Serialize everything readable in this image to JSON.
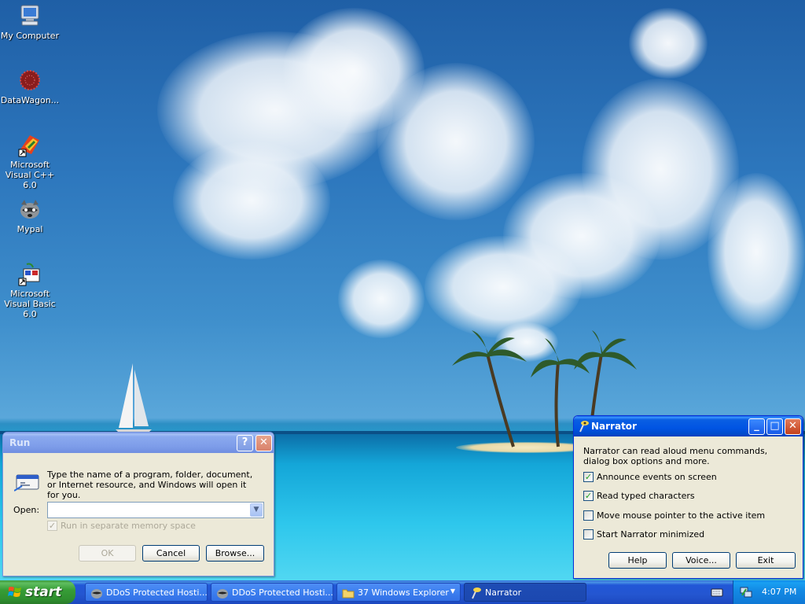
{
  "desktop": {
    "icons": [
      {
        "label": "My Computer",
        "icon": "computer-icon"
      },
      {
        "label": "DataWagon...",
        "icon": "network-globe-icon"
      },
      {
        "label": "Microsoft Visual C++ 6.0",
        "icon": "visual-cpp-icon"
      },
      {
        "label": "Mypal",
        "icon": "raccoon-browser-icon"
      },
      {
        "label": "Microsoft Visual Basic 6.0",
        "icon": "visual-basic-icon"
      }
    ]
  },
  "run_dialog": {
    "title": "Run",
    "help_button": "?",
    "close_button": "✕",
    "description": "Type the name of a program, folder, document, or Internet resource, and Windows will open it for you.",
    "open_label": "Open:",
    "open_value": "",
    "separate_memory_label": "Run in separate memory space",
    "separate_memory_checked": true,
    "ok_label": "OK",
    "cancel_label": "Cancel",
    "browse_label": "Browse..."
  },
  "narrator": {
    "title": "Narrator",
    "minimize": "_",
    "maximize": "□",
    "close": "✕",
    "description": "Narrator can read aloud menu commands, dialog box options and more.",
    "options": [
      {
        "label": "Announce events on screen",
        "checked": true
      },
      {
        "label": "Read typed characters",
        "checked": true
      },
      {
        "label": "Move mouse pointer to the active item",
        "checked": false
      },
      {
        "label": "Start Narrator minimized",
        "checked": false
      }
    ],
    "help_label": "Help",
    "voice_label": "Voice...",
    "exit_label": "Exit"
  },
  "taskbar": {
    "start_label": "start",
    "tasks": [
      {
        "label": "DDoS Protected Hosti...",
        "icon": "raccoon-browser-icon",
        "active": false
      },
      {
        "label": "DDoS Protected Hosti...",
        "icon": "raccoon-browser-icon",
        "active": false
      },
      {
        "label": "37 Windows Explorer",
        "icon": "folder-icon",
        "active": false
      },
      {
        "label": "Narrator",
        "icon": "narrator-icon",
        "active": true
      }
    ],
    "clock": "4:07 PM"
  },
  "colors": {
    "xp_blue": "#0054e3",
    "start_green": "#379d37",
    "dialog_bg": "#ece9d8"
  }
}
